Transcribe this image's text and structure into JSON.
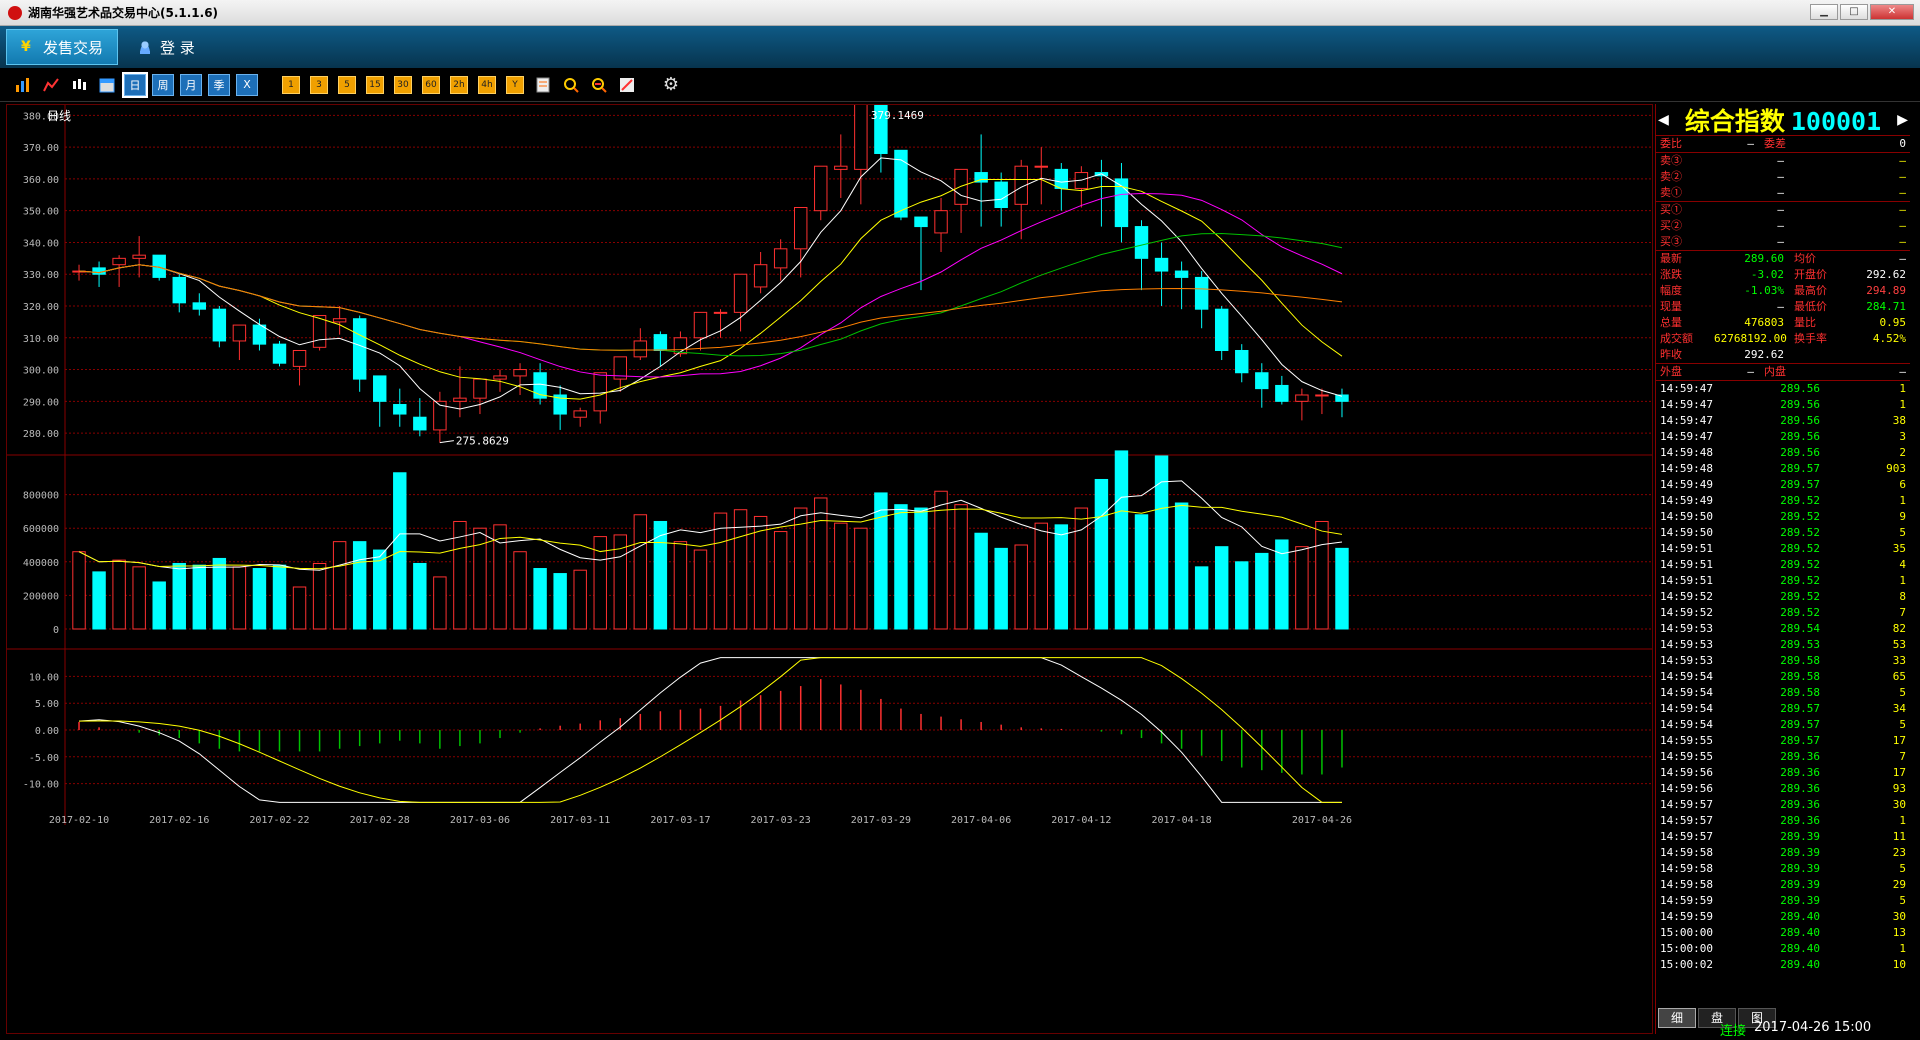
{
  "window": {
    "title": "湖南华强艺术品交易中心(5.1.1.6)"
  },
  "menu": {
    "tab_sale": "发售交易",
    "tab_login": "登 录"
  },
  "toolbar": {
    "period_buttons": [
      "日",
      "周",
      "月",
      "季",
      "X"
    ],
    "minute_buttons": [
      "1",
      "3",
      "5",
      "15",
      "30",
      "60",
      "2h",
      "4h",
      "Y"
    ]
  },
  "chart": {
    "period_label": "日线",
    "high_mark": "379.1469",
    "low_mark": "275.8629",
    "price_ticks": [
      "380.00",
      "370.00",
      "360.00",
      "350.00",
      "340.00",
      "330.00",
      "320.00",
      "310.00",
      "300.00",
      "290.00",
      "280.00"
    ],
    "volume_ticks": [
      "800000",
      "600000",
      "400000",
      "200000",
      "0"
    ],
    "macd_ticks": [
      "10.00",
      "5.00",
      "0.00",
      "-5.00",
      "-10.00"
    ],
    "date_ticks": [
      "2017-02-10",
      "2017-02-16",
      "2017-02-22",
      "2017-02-28",
      "2017-03-06",
      "2017-03-11",
      "2017-03-17",
      "2017-03-23",
      "2017-03-29",
      "2017-04-06",
      "2017-04-12",
      "2017-04-18",
      "2017-04-26"
    ]
  },
  "chart_data": {
    "type": "candlestick",
    "price": {
      "ylim": [
        275,
        382
      ],
      "ticks": [
        280,
        290,
        300,
        310,
        320,
        330,
        340,
        350,
        360,
        370,
        380
      ]
    },
    "candles": [
      [
        331,
        333,
        328,
        331
      ],
      [
        332,
        334,
        326,
        330
      ],
      [
        333,
        336,
        326,
        335
      ],
      [
        335,
        342,
        329,
        336
      ],
      [
        336,
        336,
        328,
        329
      ],
      [
        329,
        330,
        318,
        321
      ],
      [
        321,
        324,
        317,
        319
      ],
      [
        319,
        320,
        307,
        309
      ],
      [
        309,
        314,
        303,
        314
      ],
      [
        314,
        316,
        306,
        308
      ],
      [
        308,
        309,
        301,
        302
      ],
      [
        301,
        305,
        295,
        306
      ],
      [
        307,
        317,
        306,
        317
      ],
      [
        315,
        320,
        311,
        316
      ],
      [
        316,
        317,
        293,
        297
      ],
      [
        298,
        298,
        282,
        290
      ],
      [
        289,
        294,
        282,
        286
      ],
      [
        285,
        291,
        279,
        281
      ],
      [
        281,
        293,
        277,
        290
      ],
      [
        290,
        301,
        285,
        291
      ],
      [
        291,
        297,
        286,
        297
      ],
      [
        297,
        300,
        293,
        298
      ],
      [
        298,
        302,
        292,
        300
      ],
      [
        299,
        302,
        289,
        291
      ],
      [
        292,
        295,
        281,
        286
      ],
      [
        285,
        288,
        282,
        287
      ],
      [
        287,
        298,
        283,
        299
      ],
      [
        297,
        304,
        293,
        304
      ],
      [
        304,
        313,
        303,
        309
      ],
      [
        311,
        312,
        301,
        306
      ],
      [
        305,
        312,
        304,
        310
      ],
      [
        310,
        317,
        306,
        318
      ],
      [
        318,
        319,
        310,
        318
      ],
      [
        318,
        330,
        312,
        330
      ],
      [
        326,
        337,
        324,
        333
      ],
      [
        332,
        341,
        328,
        338
      ],
      [
        338,
        351,
        329,
        351
      ],
      [
        350,
        364,
        347,
        364
      ],
      [
        363,
        374,
        354,
        364
      ],
      [
        363,
        379,
        352,
        386
      ],
      [
        386,
        386,
        362,
        368
      ],
      [
        369,
        369,
        347,
        348
      ],
      [
        348,
        348,
        325,
        345
      ],
      [
        343,
        354,
        337,
        350
      ],
      [
        352,
        360,
        343,
        363
      ],
      [
        362,
        374,
        345,
        359
      ],
      [
        359,
        362,
        345,
        351
      ],
      [
        352,
        366,
        341,
        364
      ],
      [
        364,
        370,
        352,
        364
      ],
      [
        363,
        365,
        350,
        357
      ],
      [
        357,
        364,
        351,
        362
      ],
      [
        362,
        366,
        345,
        361
      ],
      [
        360,
        365,
        340,
        345
      ],
      [
        345,
        347,
        325,
        335
      ],
      [
        335,
        340,
        320,
        331
      ],
      [
        331,
        334,
        319,
        329
      ],
      [
        329,
        331,
        313,
        319
      ],
      [
        319,
        320,
        303,
        306
      ],
      [
        306,
        308,
        296,
        299
      ],
      [
        299,
        302,
        288,
        294
      ],
      [
        295,
        298,
        289,
        290
      ],
      [
        290,
        294,
        284,
        292
      ],
      [
        292,
        294,
        286,
        292
      ],
      [
        292,
        294,
        285,
        290
      ]
    ],
    "volume_ylim": [
      0,
      1000000
    ],
    "volume": [
      460000,
      340000,
      410000,
      370000,
      280000,
      390000,
      380000,
      420000,
      370000,
      360000,
      380000,
      250000,
      390000,
      520000,
      520000,
      470000,
      930000,
      390000,
      310000,
      640000,
      600000,
      620000,
      460000,
      360000,
      330000,
      350000,
      550000,
      560000,
      680000,
      640000,
      520000,
      470000,
      690000,
      710000,
      670000,
      580000,
      720000,
      780000,
      630000,
      600000,
      810000,
      740000,
      720000,
      820000,
      740000,
      570000,
      480000,
      500000,
      630000,
      620000,
      720000,
      890000,
      1060000,
      680000,
      1030000,
      750000,
      370000,
      490000,
      400000,
      450000,
      530000,
      490000,
      640000,
      480000
    ],
    "macd_ylim": [
      -14,
      14
    ],
    "macd_hist": [
      1.5,
      0.5,
      0,
      -0.5,
      -1,
      -1.5,
      -2.5,
      -3.5,
      -4,
      -4,
      -4,
      -4,
      -4,
      -3.5,
      -3,
      -2.5,
      -2,
      -2.5,
      -3.5,
      -3,
      -2.5,
      -1.5,
      -0.5,
      0.3,
      0.8,
      1.2,
      1.8,
      2.2,
      3,
      3.5,
      3.8,
      4,
      4.5,
      5.5,
      6.5,
      7.3,
      8.2,
      9.5,
      8.5,
      7.5,
      5.8,
      4,
      3,
      2.5,
      2,
      1.5,
      1,
      0.5,
      0.3,
      0.2,
      0,
      -0.3,
      -0.8,
      -1.5,
      -2.5,
      -3.5,
      -4.8,
      -5.8,
      -7,
      -7.5,
      -8,
      -8.3,
      -8.3,
      -7
    ]
  },
  "quote": {
    "name": "综合指数",
    "code": "100001",
    "ratio_label": "委比",
    "ratio_val": "—",
    "diff_label": "委差",
    "diff_val": "0",
    "sells": [
      {
        "l": "卖③",
        "v": "—",
        "q": "—"
      },
      {
        "l": "卖②",
        "v": "—",
        "q": "—"
      },
      {
        "l": "卖①",
        "v": "—",
        "q": "—"
      }
    ],
    "buys": [
      {
        "l": "买①",
        "v": "—",
        "q": "—"
      },
      {
        "l": "买②",
        "v": "—",
        "q": "—"
      },
      {
        "l": "买③",
        "v": "—",
        "q": "—"
      }
    ],
    "stats": [
      {
        "l": "最新",
        "v": "289.60",
        "l2": "均价",
        "v2": "—",
        "c": "grn",
        "c2": "val"
      },
      {
        "l": "涨跌",
        "v": "-3.02",
        "l2": "开盘价",
        "v2": "292.62",
        "c": "grn",
        "c2": "val"
      },
      {
        "l": "幅度",
        "v": "-1.03%",
        "l2": "最高价",
        "v2": "294.89",
        "c": "grn",
        "c2": "red"
      },
      {
        "l": "现量",
        "v": "—",
        "l2": "最低价",
        "v2": "284.71",
        "c": "val",
        "c2": "grn"
      },
      {
        "l": "总量",
        "v": "476803",
        "l2": "量比",
        "v2": "0.95",
        "c": "yel",
        "c2": "yel"
      },
      {
        "l": "成交额",
        "v": "62768192.00",
        "l2": "换手率",
        "v2": "4.52%",
        "c": "yel",
        "c2": "yel"
      },
      {
        "l": "昨收",
        "v": "292.62",
        "l2": "",
        "v2": "",
        "c": "val",
        "c2": "val"
      }
    ],
    "outer_label": "外盘",
    "outer_val": "—",
    "inner_label": "内盘",
    "inner_val": "—"
  },
  "ticks": [
    [
      "14:59:47",
      "289.56",
      "1"
    ],
    [
      "14:59:47",
      "289.56",
      "1"
    ],
    [
      "14:59:47",
      "289.56",
      "38"
    ],
    [
      "14:59:47",
      "289.56",
      "3"
    ],
    [
      "14:59:48",
      "289.56",
      "2"
    ],
    [
      "14:59:48",
      "289.57",
      "903"
    ],
    [
      "14:59:49",
      "289.57",
      "6"
    ],
    [
      "14:59:49",
      "289.52",
      "1"
    ],
    [
      "14:59:50",
      "289.52",
      "9"
    ],
    [
      "14:59:50",
      "289.52",
      "5"
    ],
    [
      "14:59:51",
      "289.52",
      "35"
    ],
    [
      "14:59:51",
      "289.52",
      "4"
    ],
    [
      "14:59:51",
      "289.52",
      "1"
    ],
    [
      "14:59:52",
      "289.52",
      "8"
    ],
    [
      "14:59:52",
      "289.52",
      "7"
    ],
    [
      "14:59:53",
      "289.54",
      "82"
    ],
    [
      "14:59:53",
      "289.53",
      "53"
    ],
    [
      "14:59:53",
      "289.58",
      "33"
    ],
    [
      "14:59:54",
      "289.58",
      "65"
    ],
    [
      "14:59:54",
      "289.58",
      "5"
    ],
    [
      "14:59:54",
      "289.57",
      "34"
    ],
    [
      "14:59:54",
      "289.57",
      "5"
    ],
    [
      "14:59:55",
      "289.57",
      "17"
    ],
    [
      "14:59:55",
      "289.36",
      "7"
    ],
    [
      "14:59:56",
      "289.36",
      "17"
    ],
    [
      "14:59:56",
      "289.36",
      "93"
    ],
    [
      "14:59:57",
      "289.36",
      "30"
    ],
    [
      "14:59:57",
      "289.36",
      "1"
    ],
    [
      "14:59:57",
      "289.39",
      "11"
    ],
    [
      "14:59:58",
      "289.39",
      "23"
    ],
    [
      "14:59:58",
      "289.39",
      "5"
    ],
    [
      "14:59:58",
      "289.39",
      "29"
    ],
    [
      "14:59:59",
      "289.39",
      "5"
    ],
    [
      "14:59:59",
      "289.40",
      "30"
    ],
    [
      "15:00:00",
      "289.40",
      "13"
    ],
    [
      "15:00:00",
      "289.40",
      "1"
    ],
    [
      "15:00:02",
      "289.40",
      "10"
    ]
  ],
  "tabs": [
    "细",
    "盘",
    "图"
  ],
  "status": {
    "conn": "连接",
    "time": "2017-04-26 15:00"
  },
  "colors": {
    "up": "#ff3030",
    "down": "#00ffff",
    "ma5": "#ffffff",
    "ma10": "#ffff00",
    "ma20": "#ff00ff",
    "ma30": "#00c000",
    "ma60": "#ff8000"
  }
}
